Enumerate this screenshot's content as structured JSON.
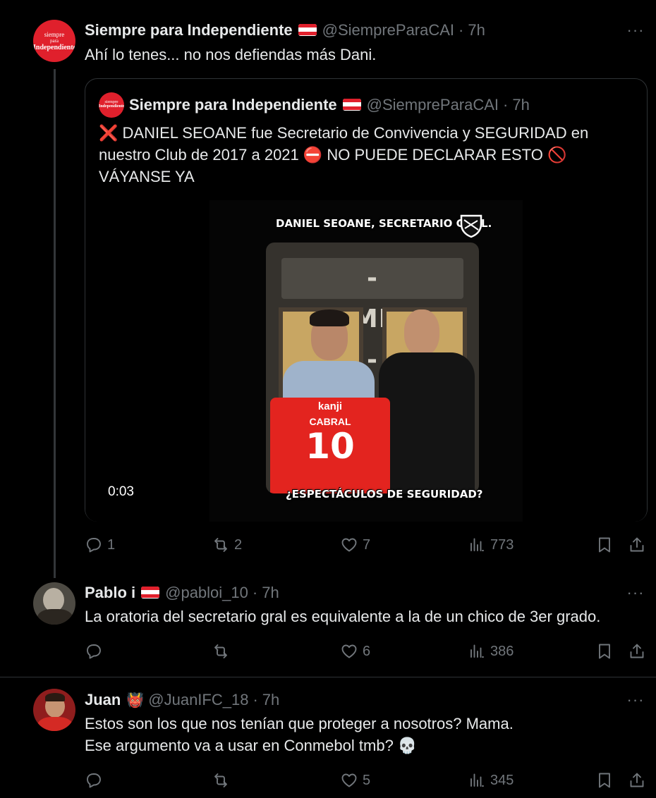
{
  "tweets": [
    {
      "name": "Siempre para Independiente",
      "handle": "@SiempreParaCAI",
      "dot": "·",
      "time": "7h",
      "text": "Ahí lo tenes... no nos defiendas más Dani.",
      "avatar_text": [
        "siempre",
        "para",
        "Independiente"
      ],
      "quote": {
        "name": "Siempre para Independiente",
        "handle": "@SiempreParaCAI",
        "dot": "·",
        "time": "7h",
        "lines": [
          "❌ DANIEL SEOANE fue Secretario de Convivencia y SEGURIDAD en",
          "nuestro Club de 2017 a 2021 ⛔ NO PUEDE DECLARAR ESTO 🚫",
          "VÁYANSE YA"
        ],
        "video": {
          "top_caption": "DANIEL SEOANE, SECRETARIO GRAL.",
          "banner": "- CONMEBOL -",
          "jersey_sponsor": "kanji",
          "jersey_name": "CABRAL",
          "jersey_number": "10",
          "bottom_caption": "¿ESPECTÁCULOS DE SEGURIDAD?",
          "duration": "0:03"
        }
      },
      "stats": {
        "replies": "1",
        "reposts": "2",
        "likes": "7",
        "views": "773"
      }
    },
    {
      "name": "Pablo i",
      "handle": "@pabloi_10",
      "dot": "·",
      "time": "7h",
      "text": "La oratoria del secretario gral es equivalente a la de un chico de 3er grado.",
      "stats": {
        "replies": "",
        "reposts": "",
        "likes": "6",
        "views": "386"
      }
    },
    {
      "name": "Juan",
      "emoji": "👹",
      "handle": "@JuanIFC_18",
      "dot": "·",
      "time": "7h",
      "lines": [
        "Estos son los que nos tenían que proteger a nosotros? Mama.",
        "Ese argumento va a usar en Conmebol tmb? 💀"
      ],
      "stats": {
        "replies": "",
        "reposts": "",
        "likes": "5",
        "views": "345"
      }
    }
  ],
  "more_label": "···",
  "colors": {
    "background": "#000000",
    "text": "#e7e9ea",
    "muted": "#71767b",
    "border": "#2f3336",
    "brand_red": "#e0202c"
  }
}
